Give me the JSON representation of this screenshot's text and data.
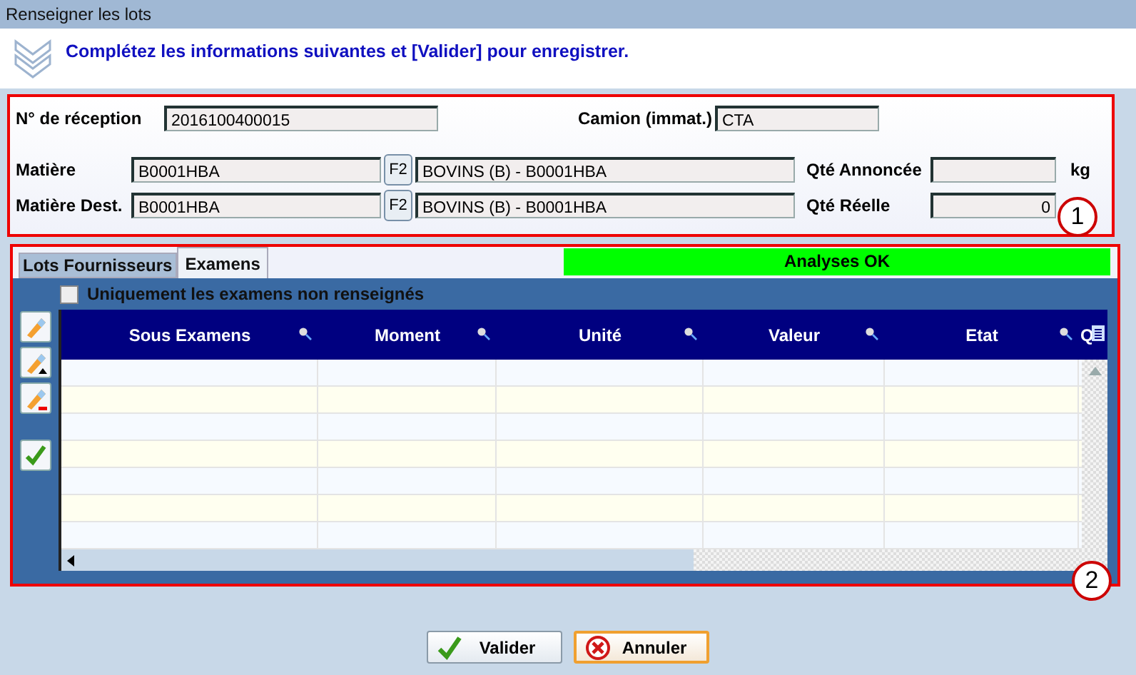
{
  "window": {
    "title": "Renseigner les lots"
  },
  "instruction": "Complétez les informations suivantes et [Valider] pour enregistrer.",
  "reception": {
    "badge": "1",
    "number_label": "N° de réception",
    "number": "2016100400015",
    "truck_label": "Camion (immat.)",
    "truck": "CTA",
    "material_rows": [
      {
        "label": "Matière",
        "code": "B0001HBA",
        "key": "F2",
        "description": "BOVINS (B) - B0001HBA",
        "qty_label": "Qté Annoncée",
        "unit": "kg"
      },
      {
        "label": "Matière Dest.",
        "code": "B0001HBA",
        "key": "F2",
        "description": "BOVINS (B) - B0001HBA",
        "qty_label": "Qté Réelle",
        "qty": "0"
      }
    ]
  },
  "tabs": [
    {
      "label": "Lots Fournisseurs",
      "selected": false
    },
    {
      "label": "Examens",
      "selected": true
    }
  ],
  "status": "Analyses OK",
  "filter": {
    "label": "Uniquement les examens non renseignés",
    "checked": false
  },
  "tools": [
    {
      "kind": "edit"
    },
    {
      "kind": "insert"
    },
    {
      "kind": "delete"
    },
    {
      "kind": "validate"
    }
  ],
  "grid": {
    "badge": "2",
    "columns": [
      "Sous Examens",
      "Moment",
      "Unité",
      "Valeur",
      "Etat"
    ],
    "extra_column": "Q"
  },
  "buttons": [
    {
      "label": "Valider",
      "kind": "confirm",
      "focused": false
    },
    {
      "label": "Annuler",
      "kind": "cancel",
      "focused": true
    }
  ]
}
